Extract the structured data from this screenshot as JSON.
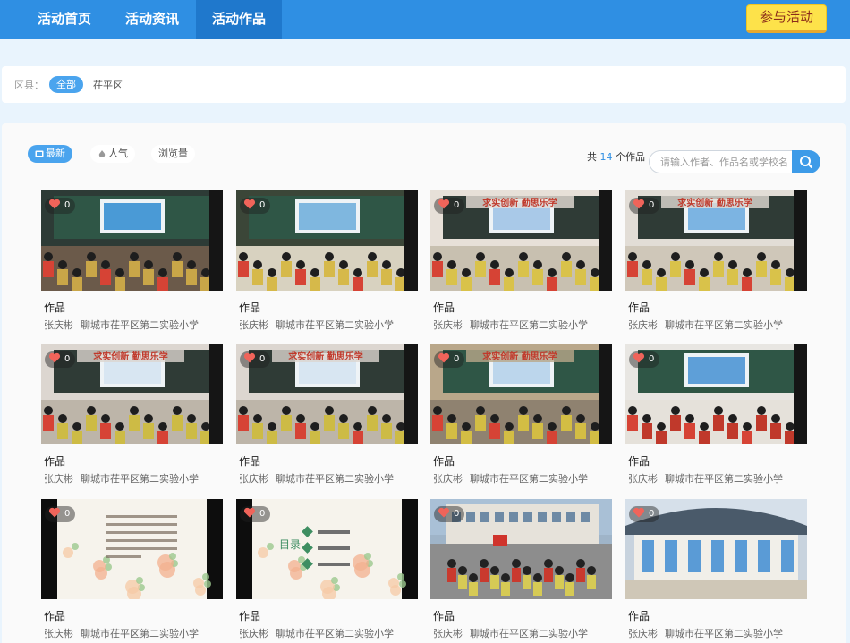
{
  "nav": {
    "items": [
      {
        "label": "活动首页"
      },
      {
        "label": "活动资讯"
      },
      {
        "label": "活动作品"
      }
    ],
    "active_index": 2,
    "join_label": "参与活动"
  },
  "filter": {
    "district_label": "区县：",
    "options": [
      "全部",
      "茌平区"
    ]
  },
  "toolbar": {
    "sort_options": [
      "最新",
      "人气",
      "浏览量"
    ],
    "count_prefix": "共",
    "count": "14",
    "count_suffix": "个作品",
    "search_placeholder": "请输入作者、作品名或学校名"
  },
  "colors": {
    "header": "#2f8fe3",
    "active_nav": "#1f78cc",
    "join_button": "#fde24a",
    "accent": "#4aa4ee",
    "like_heart": "#f0645a"
  },
  "works": [
    {
      "title": "作品",
      "author": "张庆彬",
      "school": "聊城市茌平区第二实验小学",
      "likes": "0",
      "thumb_overlay_text": ""
    },
    {
      "title": "作品",
      "author": "张庆彬",
      "school": "聊城市茌平区第二实验小学",
      "likes": "0",
      "thumb_overlay_text": ""
    },
    {
      "title": "作品",
      "author": "张庆彬",
      "school": "聊城市茌平区第二实验小学",
      "likes": "0",
      "thumb_overlay_text": "求实创新 勤思乐学"
    },
    {
      "title": "作品",
      "author": "张庆彬",
      "school": "聊城市茌平区第二实验小学",
      "likes": "0",
      "thumb_overlay_text": "求实创新 勤思乐学"
    },
    {
      "title": "作品",
      "author": "张庆彬",
      "school": "聊城市茌平区第二实验小学",
      "likes": "0",
      "thumb_overlay_text": "求实创新 勤思乐学"
    },
    {
      "title": "作品",
      "author": "张庆彬",
      "school": "聊城市茌平区第二实验小学",
      "likes": "0",
      "thumb_overlay_text": "求实创新 勤思乐学"
    },
    {
      "title": "作品",
      "author": "张庆彬",
      "school": "聊城市茌平区第二实验小学",
      "likes": "0",
      "thumb_overlay_text": "求实创新 勤思乐学"
    },
    {
      "title": "作品",
      "author": "张庆彬",
      "school": "聊城市茌平区第二实验小学",
      "likes": "0",
      "thumb_overlay_text": ""
    },
    {
      "title": "作品",
      "author": "张庆彬",
      "school": "聊城市茌平区第二实验小学",
      "likes": "0",
      "thumb_overlay_text": ""
    },
    {
      "title": "作品",
      "author": "张庆彬",
      "school": "聊城市茌平区第二实验小学",
      "likes": "0",
      "thumb_overlay_text": "目录"
    },
    {
      "title": "作品",
      "author": "张庆彬",
      "school": "聊城市茌平区第二实验小学",
      "likes": "0",
      "thumb_overlay_text": ""
    },
    {
      "title": "作品",
      "author": "张庆彬",
      "school": "聊城市茌平区第二实验小学",
      "likes": "0",
      "thumb_overlay_text": ""
    }
  ]
}
